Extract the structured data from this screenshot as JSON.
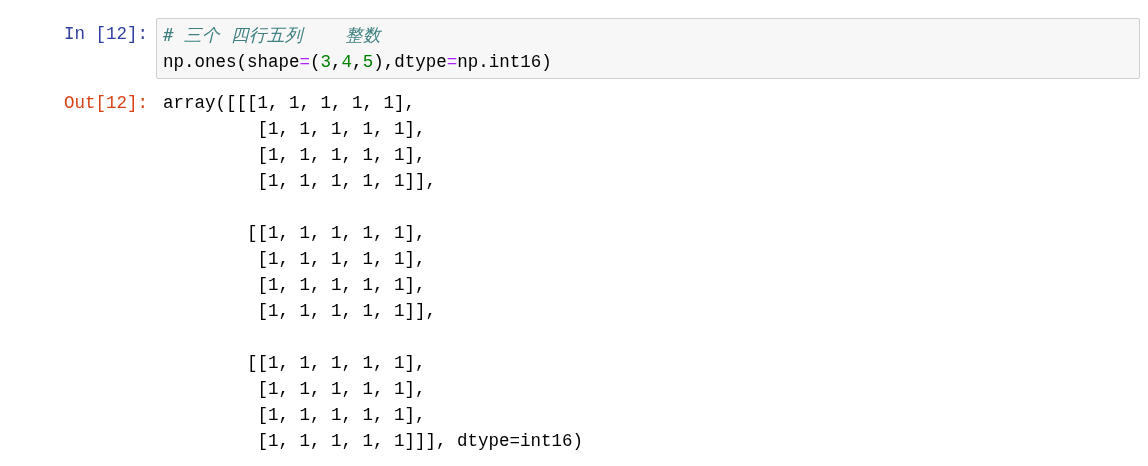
{
  "input_cell": {
    "prompt": "In [12]:",
    "lines": [
      [
        {
          "kind": "comment",
          "text": "# 三个 四行五列    整数"
        }
      ],
      [
        {
          "kind": "name",
          "text": "np.ones(shape"
        },
        {
          "kind": "op",
          "text": "="
        },
        {
          "kind": "punct",
          "text": "("
        },
        {
          "kind": "number",
          "text": "3"
        },
        {
          "kind": "punct",
          "text": ","
        },
        {
          "kind": "number",
          "text": "4"
        },
        {
          "kind": "punct",
          "text": ","
        },
        {
          "kind": "number",
          "text": "5"
        },
        {
          "kind": "punct",
          "text": "),dtype"
        },
        {
          "kind": "op",
          "text": "="
        },
        {
          "kind": "name",
          "text": "np.int16)"
        }
      ]
    ]
  },
  "output_cell": {
    "prompt": "Out[12]:",
    "blocks": [
      [
        "array([[[1, 1, 1, 1, 1],",
        "         [1, 1, 1, 1, 1],",
        "         [1, 1, 1, 1, 1],",
        "         [1, 1, 1, 1, 1]],"
      ],
      [
        "        [[1, 1, 1, 1, 1],",
        "         [1, 1, 1, 1, 1],",
        "         [1, 1, 1, 1, 1],",
        "         [1, 1, 1, 1, 1]],"
      ],
      [
        "        [[1, 1, 1, 1, 1],",
        "         [1, 1, 1, 1, 1],",
        "         [1, 1, 1, 1, 1],",
        "         [1, 1, 1, 1, 1]]], dtype=int16)"
      ]
    ]
  }
}
